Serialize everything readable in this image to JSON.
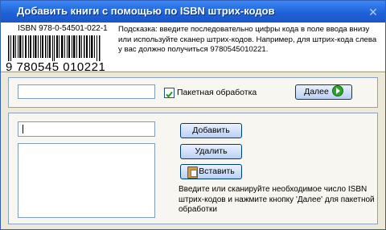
{
  "window": {
    "title": "Добавить книги с помощью по ISBN штрих-кодов",
    "close_glyph": "✕"
  },
  "example": {
    "isbn_label": "ISBN 978-0-54501-022-1",
    "barcode_digits": "9 780545 010221"
  },
  "hint": "Подсказка: введите последовательно цифры кода в поле ввода внизу или используйте сканер штрих-кодов. Например, для штрих-кода слева у вас должно получиться 9780545010221.",
  "single": {
    "input_value": "",
    "batch_checkbox_label": "Пакетная обработка",
    "batch_checked": true,
    "next_button": "Далее"
  },
  "batch": {
    "input_value": "",
    "list_items": [],
    "add_button": "Добавить",
    "delete_button": "Удалить",
    "paste_button": "Вставить",
    "help_text": "Введите или сканируйте необходимое число ISBN штрих-кодов и нажмите кнопку 'Далее' для пакетной обработки"
  },
  "icons": [
    "close-icon",
    "barcode-icon",
    "next-arrow-icon",
    "paste-icon",
    "checkbox-check-icon"
  ]
}
